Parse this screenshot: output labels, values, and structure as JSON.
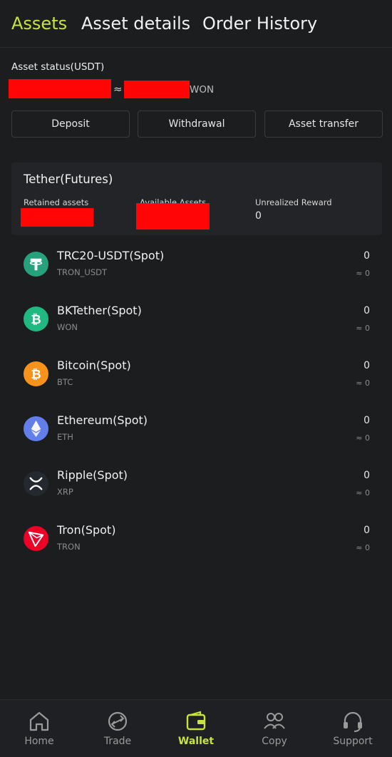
{
  "tabs": {
    "assets": "Assets",
    "asset_details": "Asset details",
    "order_history": "Order History"
  },
  "asset_status": {
    "label": "Asset status(USDT)",
    "approx_symbol": "≈",
    "currency": "WON"
  },
  "actions": {
    "deposit": "Deposit",
    "withdrawal": "Withdrawal",
    "asset_transfer": "Asset transfer"
  },
  "futures": {
    "title": "Tether(Futures)",
    "retained_label": "Retained assets",
    "available_label": "Available Assets",
    "unrealized_label": "Unrealized Reward",
    "unrealized_value": "0"
  },
  "assets": [
    {
      "name": "TRC20-USDT(Spot)",
      "sub": "TRON_USDT",
      "value": "0",
      "approx": "≈ 0",
      "icon": "tether-icon",
      "color": "#26a17b"
    },
    {
      "name": "BKTether(Spot)",
      "sub": "WON",
      "value": "0",
      "approx": "≈ 0",
      "icon": "bktether-icon",
      "color": "#20b981"
    },
    {
      "name": "Bitcoin(Spot)",
      "sub": "BTC",
      "value": "0",
      "approx": "≈ 0",
      "icon": "bitcoin-icon",
      "color": "#f7931a"
    },
    {
      "name": "Ethereum(Spot)",
      "sub": "ETH",
      "value": "0",
      "approx": "≈ 0",
      "icon": "ethereum-icon",
      "color": "#627eea"
    },
    {
      "name": "Ripple(Spot)",
      "sub": "XRP",
      "value": "0",
      "approx": "≈ 0",
      "icon": "ripple-icon",
      "color": "#23292f"
    },
    {
      "name": "Tron(Spot)",
      "sub": "TRON",
      "value": "0",
      "approx": "≈ 0",
      "icon": "tron-icon",
      "color": "#ef0027"
    }
  ],
  "nav": {
    "home": "Home",
    "trade": "Trade",
    "wallet": "Wallet",
    "copy": "Copy",
    "support": "Support"
  },
  "colors": {
    "accent": "#c7e43a",
    "background": "#1c1d1f",
    "redaction": "#ff0505"
  }
}
